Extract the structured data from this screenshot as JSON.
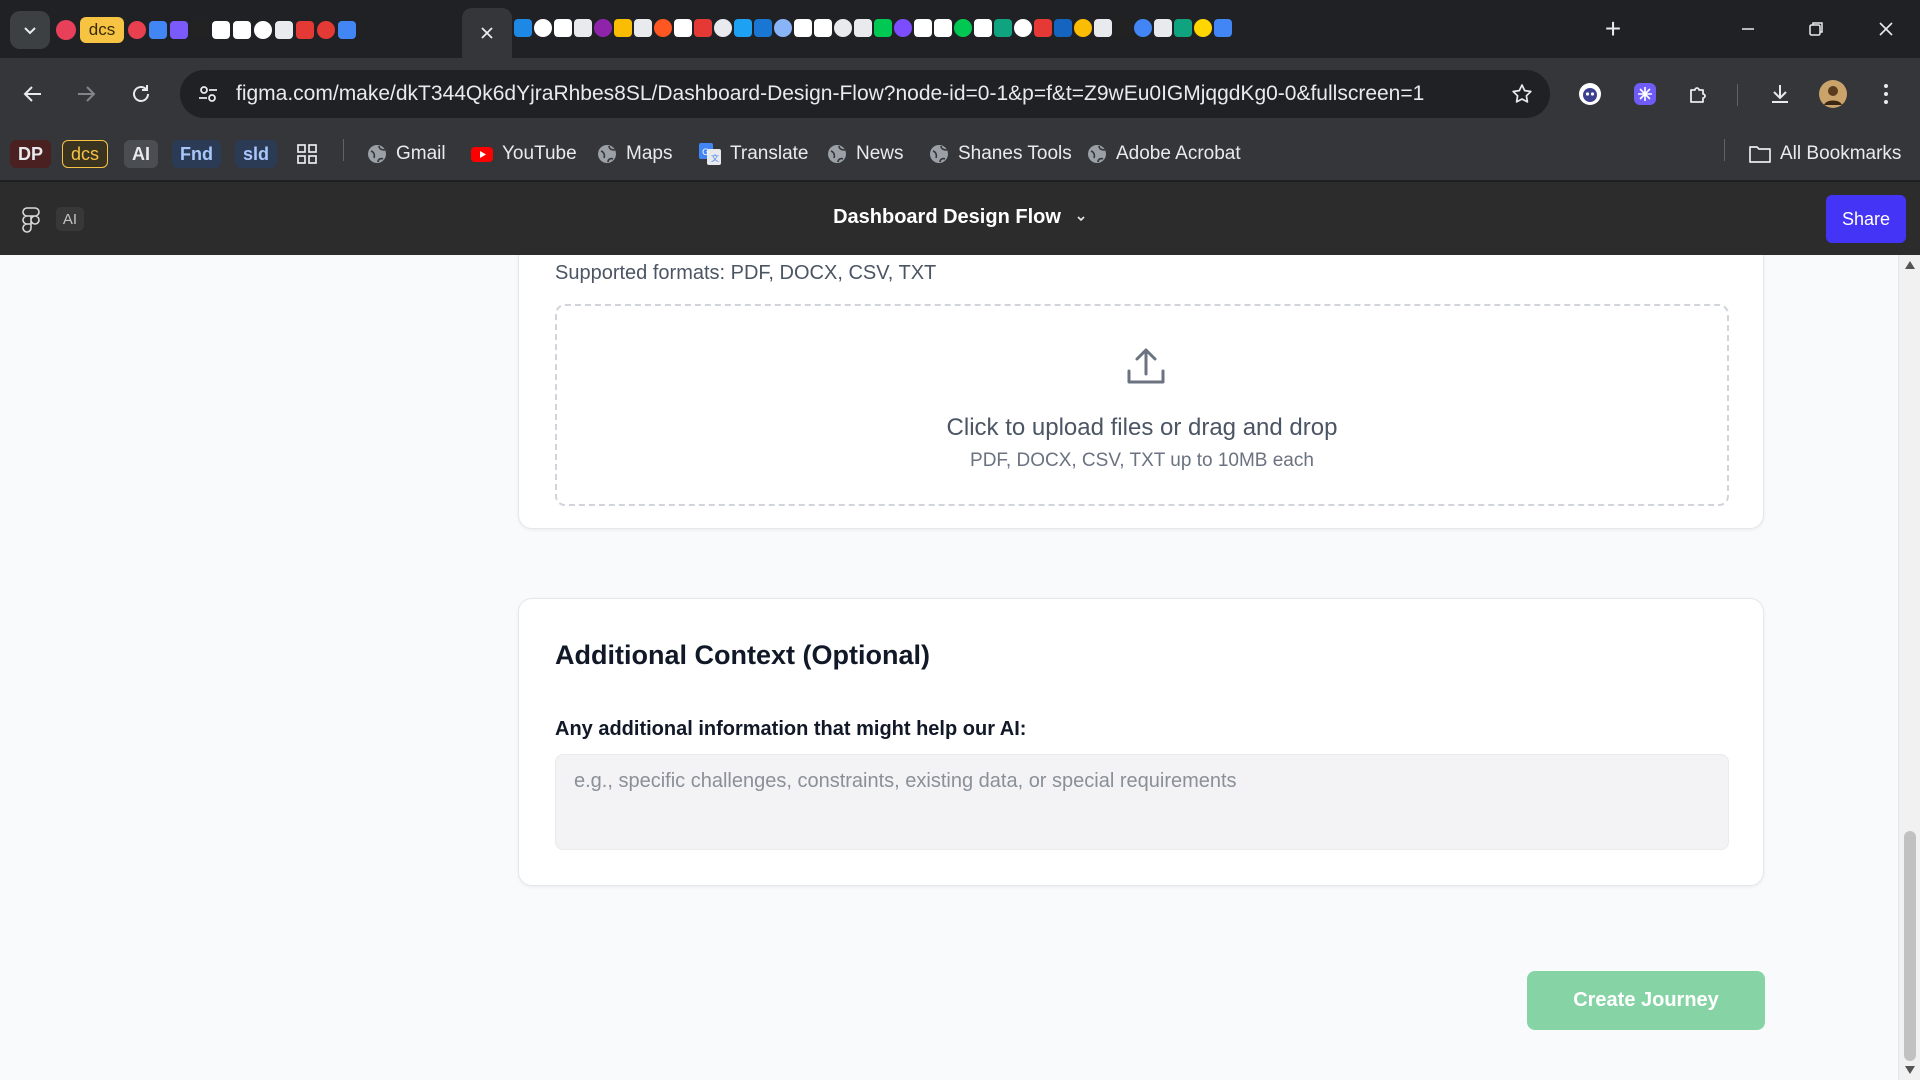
{
  "browser": {
    "pinned_tabs": [
      {
        "icon": "lotus-icon",
        "color": "#e8405a"
      },
      {
        "label": "dcs",
        "icon": "dcs-badge-icon",
        "color": "#f6c343"
      }
    ],
    "tab_favicons": [
      "#e8404e",
      "#4285f4",
      "#7a5af8",
      "#222222",
      "#ffffff",
      "#ffffff",
      "#ffffff",
      "#e8eaed",
      "#e53935",
      "#e53935",
      "#4285f4",
      "#1e88e5",
      "#ffffff",
      "#ffffff",
      "#e8eaed",
      "#8e24aa",
      "#fbbc04",
      "#e8eaed",
      "#ff5722",
      "#ffffff",
      "#e53935",
      "#e8eaed",
      "#1da1f2",
      "#1976d2",
      "#8ab4f8",
      "#ffffff",
      "#ffffff",
      "#e8eaed",
      "#e8eaed",
      "#00c853",
      "#7c4dff",
      "#ffffff",
      "#ffffff",
      "#00c853",
      "#ffffff",
      "#10a37f",
      "#ffffff",
      "#e53935",
      "#1565c0",
      "#fbbc04",
      "#e8eaed",
      "#222222",
      "#4285f4",
      "#e8eaed",
      "#10a37f",
      "#ffd600",
      "#4285f4"
    ],
    "active_tab": {
      "close_icon": "close-icon"
    },
    "new_tab_label": "+",
    "address": "figma.com/make/dkT344Qk6dYjraRhbes8SL/Dashboard-Design-Flow?node-id=0-1&p=f&t=Z9wEu0IGMjqgdKg0-0&fullscreen=1",
    "bookmarks": [
      {
        "label": "DP",
        "kind": "chip",
        "color": "#e8eaed",
        "bg": "#4a2020"
      },
      {
        "label": "dcs",
        "kind": "chip",
        "color": "#f6c343",
        "bg": "#3a3320"
      },
      {
        "label": "AI",
        "kind": "chip",
        "color": "#e8eaed",
        "bg": "#4a4d52"
      },
      {
        "label": "Fnd",
        "kind": "chip",
        "color": "#a8c7fa",
        "bg": "#2b3a55"
      },
      {
        "label": "sld",
        "kind": "chip",
        "color": "#a8c7fa",
        "bg": "#2b3a55"
      },
      {
        "label": "Gmail",
        "icon": "globe-icon"
      },
      {
        "label": "YouTube",
        "icon": "youtube-icon"
      },
      {
        "label": "Maps",
        "icon": "globe-icon"
      },
      {
        "label": "Translate",
        "icon": "translate-icon"
      },
      {
        "label": "News",
        "icon": "globe-icon"
      },
      {
        "label": "Shanes Tools",
        "icon": "globe-icon"
      },
      {
        "label": "Adobe Acrobat",
        "icon": "globe-icon"
      }
    ],
    "all_bookmarks_label": "All Bookmarks"
  },
  "figma": {
    "ai_badge": "AI",
    "file_title": "Dashboard Design Flow",
    "share_label": "Share",
    "accent": "#4434f5"
  },
  "upload": {
    "supported_formats": "Supported formats: PDF, DOCX, CSV, TXT",
    "dropzone_title": "Click to upload files or drag and drop",
    "dropzone_subtitle": "PDF, DOCX, CSV, TXT up to 10MB each"
  },
  "context": {
    "title": "Additional Context (Optional)",
    "label": "Any additional information that might help our AI:",
    "value": "",
    "placeholder": "e.g., specific challenges, constraints, existing data, or special requirements"
  },
  "actions": {
    "create_label": "Create Journey",
    "create_color": "#86d4a6"
  }
}
